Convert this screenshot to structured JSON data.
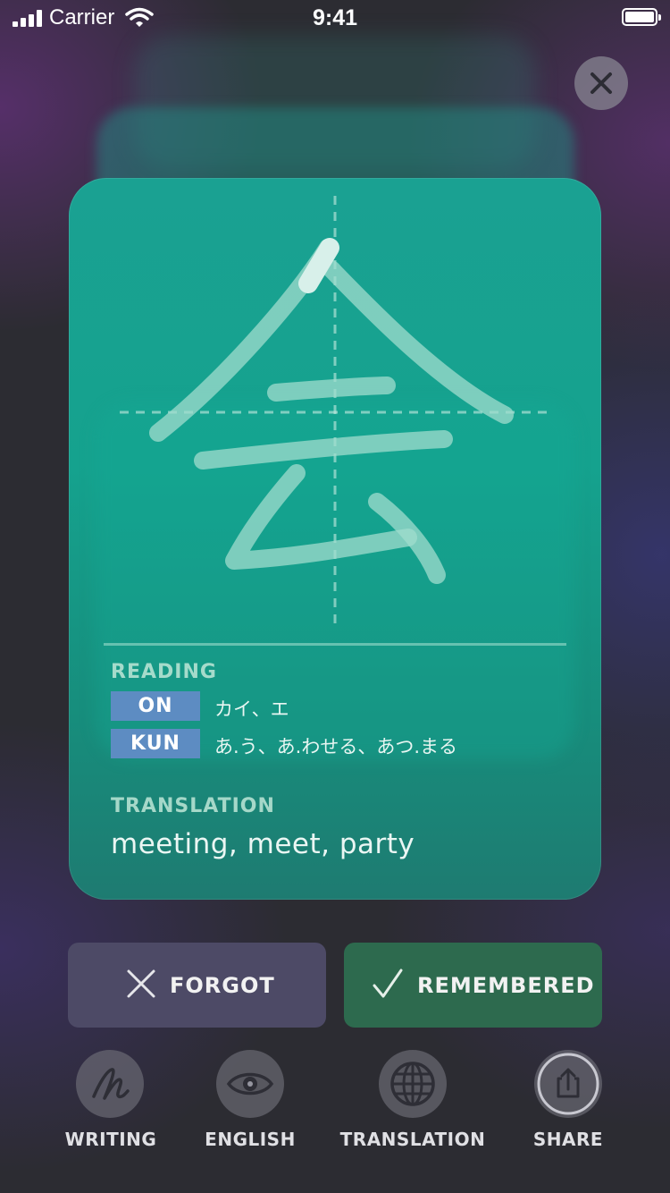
{
  "status_bar": {
    "carrier": "Carrier",
    "time": "9:41"
  },
  "card": {
    "kanji": "会",
    "reading_label": "READING",
    "on_label": "ON",
    "on_reading": "カイ、エ",
    "kun_label": "KUN",
    "kun_reading": "あ.う、あ.わせる、あつ.まる",
    "translation_label": "TRANSLATION",
    "translation": "meeting, meet, party"
  },
  "actions": {
    "forgot": "FORGOT",
    "remembered": "REMEMBERED"
  },
  "toolbar": {
    "items": [
      {
        "label": "WRITING",
        "icon": "writing-icon"
      },
      {
        "label": "ENGLISH",
        "icon": "eye-icon"
      },
      {
        "label": "TRANSLATION",
        "icon": "globe-icon"
      },
      {
        "label": "SHARE",
        "icon": "share-icon"
      }
    ]
  },
  "colors": {
    "card": "#15a28e",
    "forgot_button": "#4d4a66",
    "remembered_button": "#2d6a4e",
    "badge": "#5d8cc2"
  }
}
